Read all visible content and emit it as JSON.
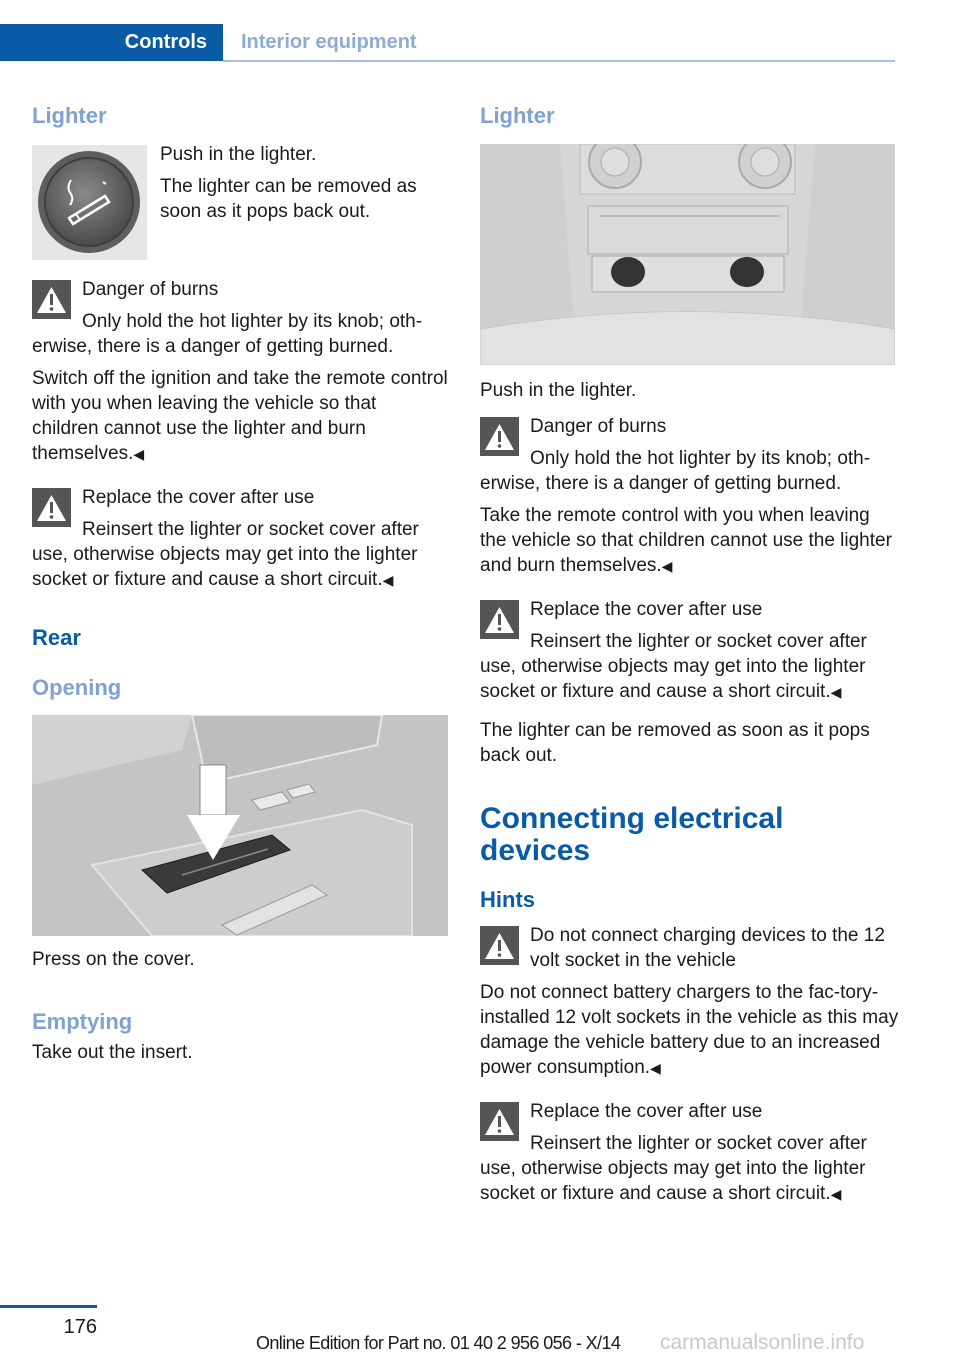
{
  "header": {
    "active_tab": "Controls",
    "section_tab": "Interior equipment"
  },
  "left": {
    "lighter_heading": "Lighter",
    "lighter_icon": "cigarette-lighter-icon",
    "lighter_p1": "Push in the lighter.",
    "lighter_p2": "The lighter can be removed as soon as it pops back out.",
    "warning1": {
      "icon": "warning-triangle-icon",
      "title": "Danger of burns",
      "body": "Only hold the hot lighter by its knob; oth-erwise, there is a danger of getting burned."
    },
    "para_switch_off": "Switch off the ignition and take the remote control with you when leaving the vehicle so that children cannot use the lighter and burn themselves.",
    "warning2": {
      "icon": "warning-triangle-icon",
      "title": "Replace the cover after use",
      "body": "Reinsert the lighter or socket cover after use, otherwise objects may get into the lighter socket or fixture and cause a short circuit."
    },
    "rear_heading": "Rear",
    "opening_heading": "Opening",
    "opening_image_alt": "Door armrest ashtray cover with press arrow",
    "opening_caption": "Press on the cover.",
    "emptying_heading": "Emptying",
    "emptying_text": "Take out the insert."
  },
  "right": {
    "lighter_heading": "Lighter",
    "lighter_image_alt": "Rear center console with two lighter sockets",
    "push_text": "Push in the lighter.",
    "warning1": {
      "icon": "warning-triangle-icon",
      "title": "Danger of burns",
      "body": "Only hold the hot lighter by its knob; oth-erwise, there is a danger of getting burned."
    },
    "para_remote": "Take the remote control with you when leaving the vehicle so that children cannot use the lighter and burn themselves.",
    "warning2": {
      "icon": "warning-triangle-icon",
      "title": "Replace the cover after use",
      "body": "Reinsert the lighter or socket cover after use, otherwise objects may get into the lighter socket or fixture and cause a short circuit."
    },
    "para_removed": "The lighter can be removed as soon as it pops back out.",
    "connecting_heading": "Connecting electrical devices",
    "hints_heading": "Hints",
    "warning3": {
      "icon": "warning-triangle-icon",
      "title": "Do not connect charging devices to the 12 volt socket in the vehicle",
      "body": "Do not connect battery chargers to the fac-tory-installed 12 volt sockets in the vehicle as this may damage the vehicle battery due to an increased power consumption."
    },
    "warning4": {
      "icon": "warning-triangle-icon",
      "title": "Replace the cover after use",
      "body": "Reinsert the lighter or socket cover after use, otherwise objects may get into the lighter socket or fixture and cause a short circuit."
    }
  },
  "footer": {
    "page_number": "176",
    "edition": "Online Edition for Part no. 01 40 2 956 056 - X/14",
    "watermark": "carmanualsonline.info"
  },
  "end_mark": "◀",
  "colors": {
    "brand_blue": "#0a5ba6",
    "light_blue": "#7ea2d1",
    "warning_gray": "#555555"
  }
}
